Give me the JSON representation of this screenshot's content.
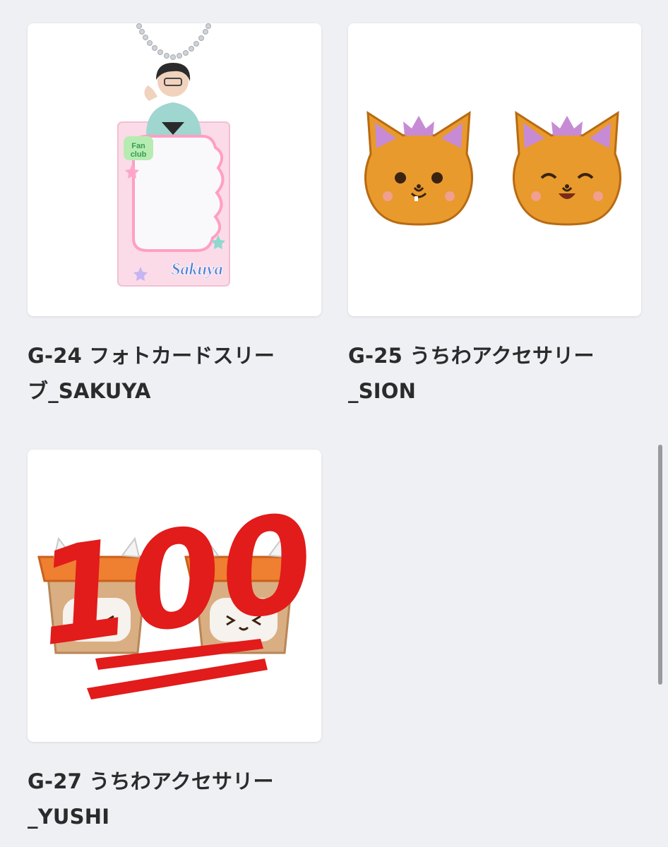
{
  "products": [
    {
      "title_line1": "G-24 フォトカードスリー",
      "title_line2": "ブ_SAKUYA",
      "image": {
        "sleeve_name": "Sakuya",
        "badge_text": "Fan\nclub"
      }
    },
    {
      "title_line1": "G-25 うちわアクセサリー",
      "title_line2": "_SION",
      "image": {}
    },
    {
      "title_line1": "G-27 うちわアクセサリー",
      "title_line2": "_YUSHI",
      "image": {
        "emoji_text": "100"
      }
    }
  ],
  "colors": {
    "page_bg": "#eff0f4",
    "card_bg": "#ffffff",
    "title_text": "#2b2b2b",
    "fox_orange": "#e89a2c",
    "crown_purple": "#c78bd6",
    "hundred_red": "#e21b1b"
  }
}
